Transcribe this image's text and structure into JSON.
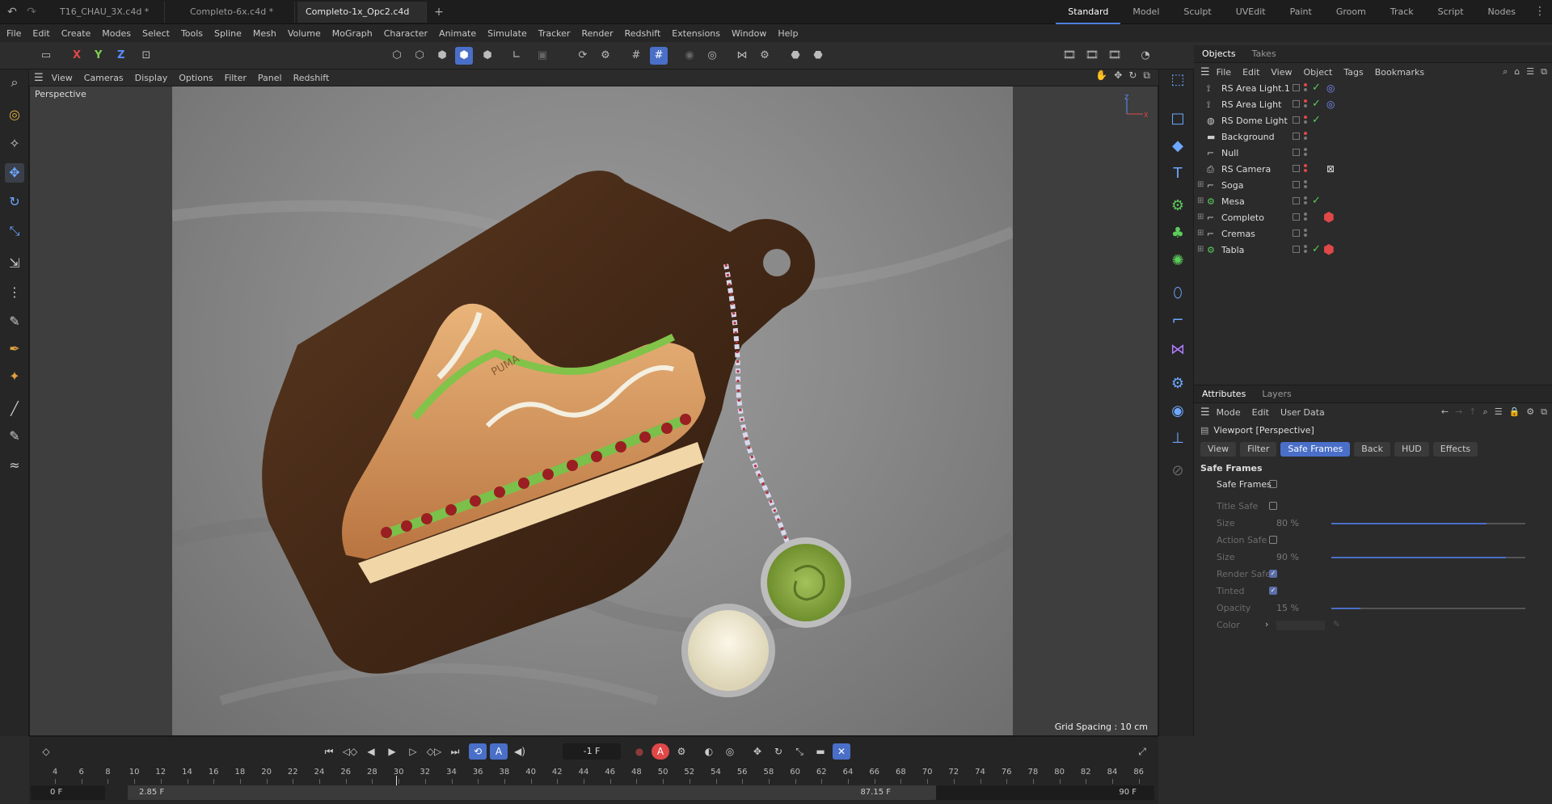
{
  "tabs": [
    {
      "label": "T16_CHAU_3X.c4d *"
    },
    {
      "label": "Completo-6x.c4d *"
    },
    {
      "label": "Completo-1x_Opc2.c4d *"
    }
  ],
  "layouts": [
    "Standard",
    "Model",
    "Sculpt",
    "UVEdit",
    "Paint",
    "Groom",
    "Track",
    "Script",
    "Nodes"
  ],
  "menu": [
    "File",
    "Edit",
    "Create",
    "Modes",
    "Select",
    "Tools",
    "Spline",
    "Mesh",
    "Volume",
    "MoGraph",
    "Character",
    "Animate",
    "Simulate",
    "Tracker",
    "Render",
    "Redshift",
    "Extensions",
    "Window",
    "Help"
  ],
  "axes": {
    "x": "X",
    "y": "Y",
    "z": "Z"
  },
  "viewport": {
    "menu": [
      "View",
      "Cameras",
      "Display",
      "Options",
      "Filter",
      "Panel",
      "Redshift"
    ],
    "label": "Perspective",
    "grid_spacing": "Grid Spacing : 10 cm",
    "gizmo_axes": [
      "Z",
      "X"
    ],
    "logo_text": "PUMA"
  },
  "objects_panel": {
    "tabs": [
      "Objects",
      "Takes"
    ],
    "menu": [
      "File",
      "Edit",
      "View",
      "Object",
      "Tags",
      "Bookmarks"
    ],
    "items": [
      {
        "name": "RS Area Light.1",
        "icon": "light-icon",
        "check": "✓",
        "tag": "◎",
        "tag_color": "#7d8cff"
      },
      {
        "name": "RS Area Light",
        "icon": "light-icon",
        "check": "✓",
        "tag": "◎",
        "tag_color": "#7d8cff"
      },
      {
        "name": "RS Dome Light",
        "icon": "dome-icon",
        "check": "✓",
        "tag": ""
      },
      {
        "name": "Background",
        "icon": "background-icon",
        "check": "",
        "tag": ""
      },
      {
        "name": "Null",
        "icon": "null-icon",
        "check": "",
        "tag": ""
      },
      {
        "name": "RS Camera",
        "icon": "camera-icon",
        "check": "",
        "tag": "⊠",
        "tag_color": "#dddddd"
      },
      {
        "name": "Soga",
        "icon": "null-icon",
        "check": "",
        "tag": ""
      },
      {
        "name": "Mesa",
        "icon": "group-icon",
        "check": "✓",
        "tag": ""
      },
      {
        "name": "Completo",
        "icon": "null-icon",
        "check": "",
        "tag": "⬢",
        "tag_color": "#e04848"
      },
      {
        "name": "Cremas",
        "icon": "null-icon",
        "check": "",
        "tag": ""
      },
      {
        "name": "Tabla",
        "icon": "group-icon",
        "check": "✓",
        "tag": "⬢",
        "tag_color": "#e04848"
      }
    ]
  },
  "attributes_panel": {
    "tabs": [
      "Attributes",
      "Layers"
    ],
    "menu": [
      "Mode",
      "Edit",
      "User Data"
    ],
    "title": "Viewport [Perspective]",
    "sub_tabs": [
      "View",
      "Filter",
      "Safe Frames",
      "Back",
      "HUD",
      "Effects"
    ],
    "section": "Safe Frames",
    "rows": {
      "safe_frames": {
        "label": "Safe Frames"
      },
      "title_safe": {
        "label": "Title Safe"
      },
      "title_size": {
        "label": "Size",
        "value": "80 %",
        "fraction": 0.8
      },
      "action_safe": {
        "label": "Action Safe"
      },
      "action_size": {
        "label": "Size",
        "value": "90 %",
        "fraction": 0.9
      },
      "render_safe": {
        "label": "Render Safe"
      },
      "tinted": {
        "label": "Tinted"
      },
      "opacity": {
        "label": "Opacity",
        "value": "15 %",
        "fraction": 0.15
      },
      "color": {
        "label": "Color"
      }
    }
  },
  "timeline": {
    "current_frame": "-1 F",
    "ruler": [
      "4",
      "6",
      "8",
      "10",
      "12",
      "14",
      "16",
      "18",
      "20",
      "22",
      "24",
      "26",
      "28",
      "30",
      "32",
      "34",
      "36",
      "38",
      "40",
      "42",
      "44",
      "46",
      "48",
      "50",
      "52",
      "54",
      "56",
      "58",
      "60",
      "62",
      "64",
      "66",
      "68",
      "70",
      "72",
      "74",
      "76",
      "78",
      "80",
      "82",
      "84",
      "86"
    ],
    "range_start": "0 F",
    "preview_start": "2.85 F",
    "preview_end": "87.15 F",
    "range_end": "90 F"
  },
  "colors": {
    "accent": "#4a6fc8",
    "red": "#e04848",
    "green": "#5ccd5c"
  }
}
